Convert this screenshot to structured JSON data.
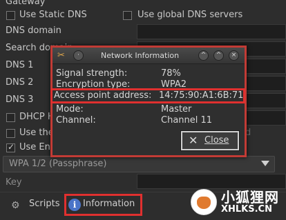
{
  "settings": {
    "gateway_label": "Gateway",
    "use_static_dns": "Use Static DNS",
    "use_global_dns": "Use global DNS servers",
    "dns_domain": "DNS domain",
    "search_domain": "Search domain",
    "dns1": "DNS 1",
    "dns2": "DNS 2",
    "dns3": "DNS 3",
    "dhcp_hostname": "DHCP H",
    "use_the": "Use the",
    "use_enc": "Use En",
    "encryption_combo": "WPA 1/2 (Passphrase)",
    "key_label": "Key"
  },
  "tabs": {
    "scripts": "Scripts",
    "information": "Information"
  },
  "dialog": {
    "title": "Network Information",
    "rows": [
      {
        "key": "Signal strength:",
        "value": "78%"
      },
      {
        "key": "Encryption type:",
        "value": "WPA2"
      },
      {
        "key": "Access point address:",
        "value": "14:75:90:A1:6B:71"
      },
      {
        "key": "Mode:",
        "value": "Master"
      },
      {
        "key": "Channel:",
        "value": "Channel 11"
      }
    ],
    "close_button": "Close"
  },
  "watermark": {
    "cn": "小狐狸网",
    "en": "XHLKS.CN"
  },
  "colors": {
    "highlight": "#e0302f",
    "background": "#2d2d2d"
  }
}
